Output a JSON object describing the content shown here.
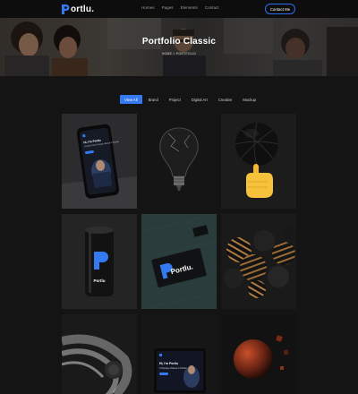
{
  "nav": {
    "logo_text": "ortlu.",
    "menu": [
      "Homes",
      "Pages",
      "Elements",
      "Contact"
    ],
    "contact_label": "Contact Me"
  },
  "hero": {
    "title": "Portfolio Classic",
    "breadcrumb": "HOME  >  PORTFOLIO"
  },
  "filters": [
    "View All",
    "Brand",
    "Project",
    "Digital Art",
    "Creative",
    "Mockup"
  ],
  "tiles": [
    {
      "name": "phone-mockup",
      "phone_text": "Hi, I'm Portlu",
      "phone_sub": "Creative Web Designer Based in Florida"
    },
    {
      "name": "broken-lightbulb"
    },
    {
      "name": "basketball-hand"
    },
    {
      "name": "soda-can",
      "can_text": "Portlu"
    },
    {
      "name": "business-card",
      "card_text": "Portlu."
    },
    {
      "name": "striped-spheres"
    },
    {
      "name": "dark-spiral"
    },
    {
      "name": "laptop-mockup",
      "screen_text": "Hi, I'm Portlu",
      "screen_sub": "UI Designer Based in Florida"
    },
    {
      "name": "red-planet"
    }
  ],
  "colors": {
    "accent": "#3479ef",
    "background": "#141414",
    "tile": "#1f1f1f"
  }
}
